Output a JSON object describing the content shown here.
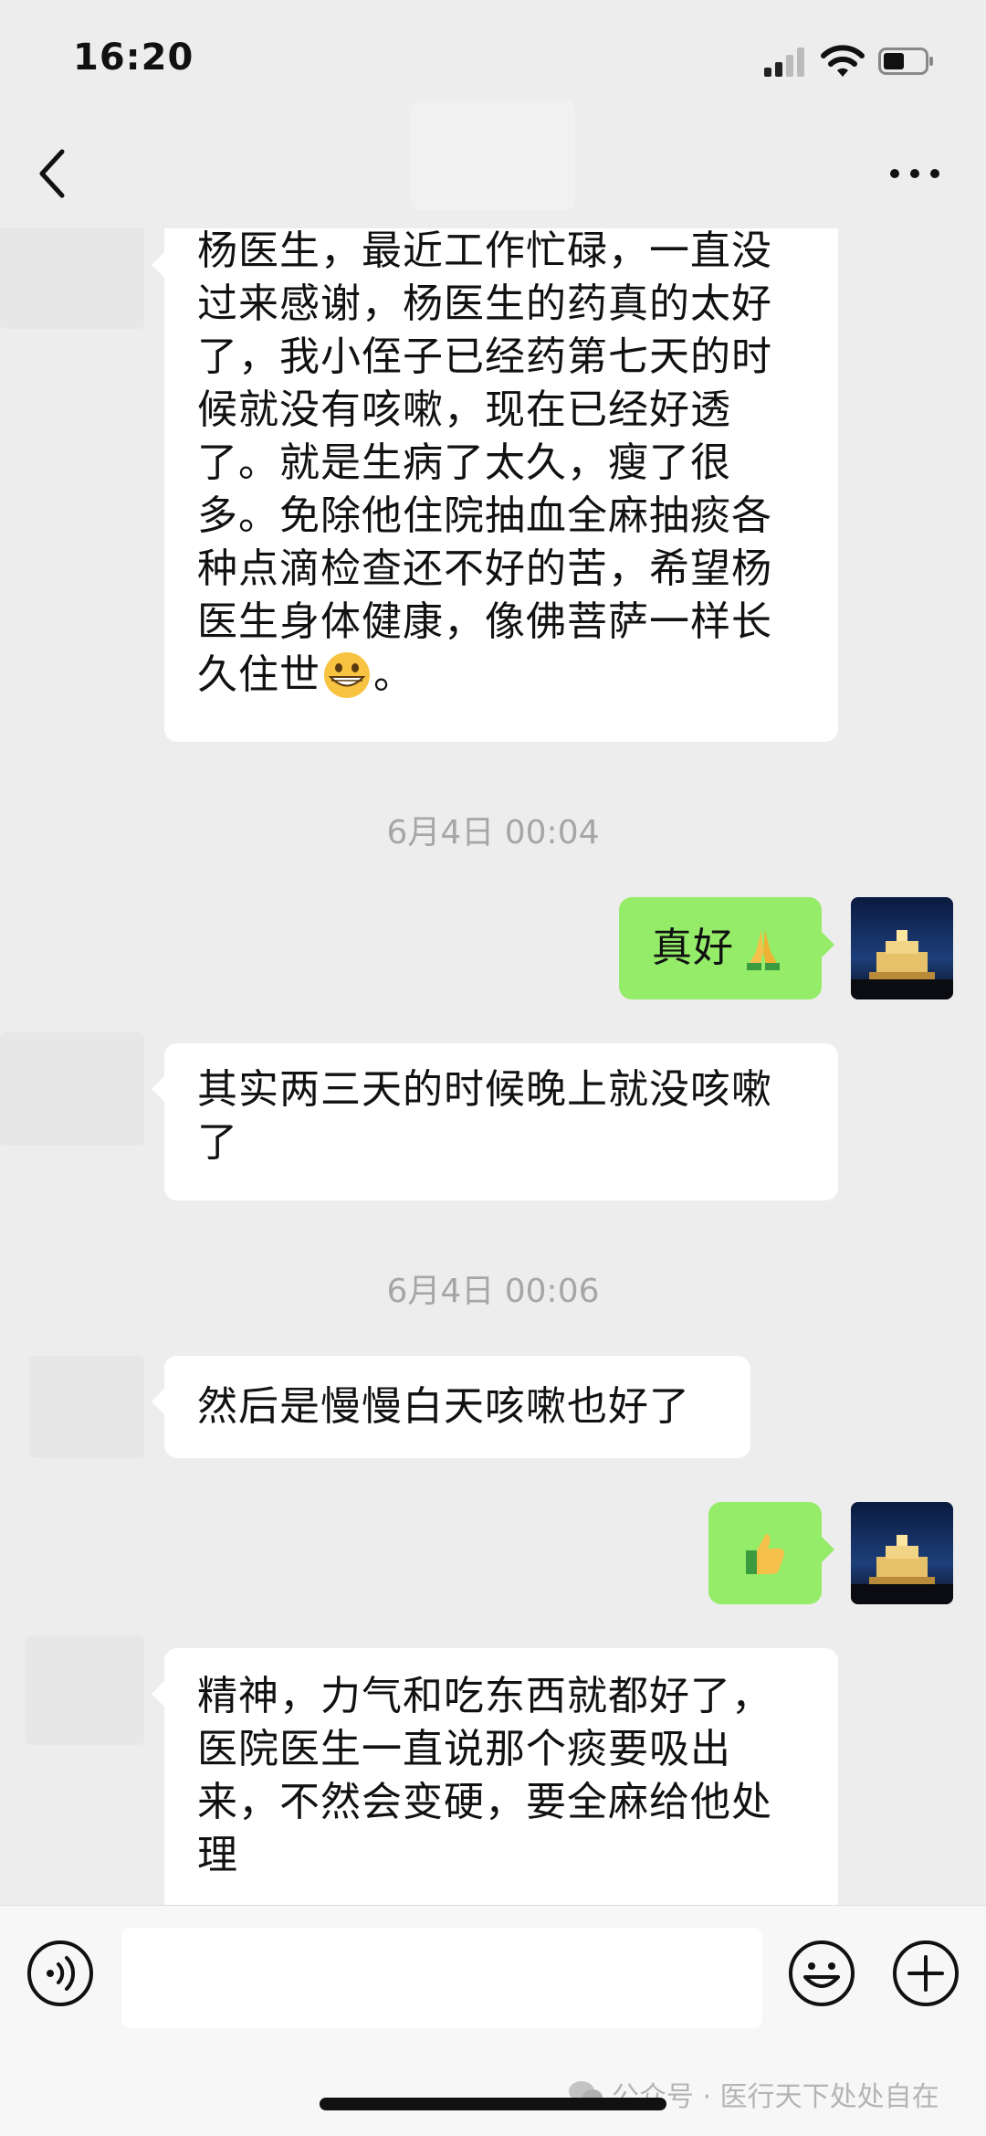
{
  "status_bar": {
    "time": "16:20"
  },
  "messages": {
    "m1": [
      "杨医生，最近工作忙碌，一直没",
      "过来感谢，杨医生的药真的太好",
      "了，我小侄子已经药第七天的时",
      "候就没有咳嗽，现在已经好透",
      "了。就是生病了太久，瘦了很",
      "多。免除他住院抽血全麻抽痰各",
      "种点滴检查还不好的苦，希望杨",
      "医生身体健康，像佛菩萨一样长",
      "久住世",
      "。"
    ],
    "t1": "6月4日 00:04",
    "m2": "真好",
    "m3": [
      "其实两三天的时候晚上就没咳嗽",
      "了"
    ],
    "t2": "6月4日 00:06",
    "m4": "然后是慢慢白天咳嗽也好了",
    "m6": [
      "精神，力气和吃东西就都好了，",
      "医院医生一直说那个痰要吸出",
      "来，不然会变硬，要全麻给他处",
      "理"
    ]
  },
  "icons": {
    "grin_emoji": "grinning-face-emoji",
    "pray_emoji": "folded-hands-emoji",
    "thumbs_emoji": "thumbs-up-emoji"
  },
  "colors": {
    "background": "#ededed",
    "sent_bubble": "#95ec69",
    "received_bubble": "#ffffff"
  },
  "watermark": {
    "text": "公众号 · 医行天下处处自在"
  }
}
